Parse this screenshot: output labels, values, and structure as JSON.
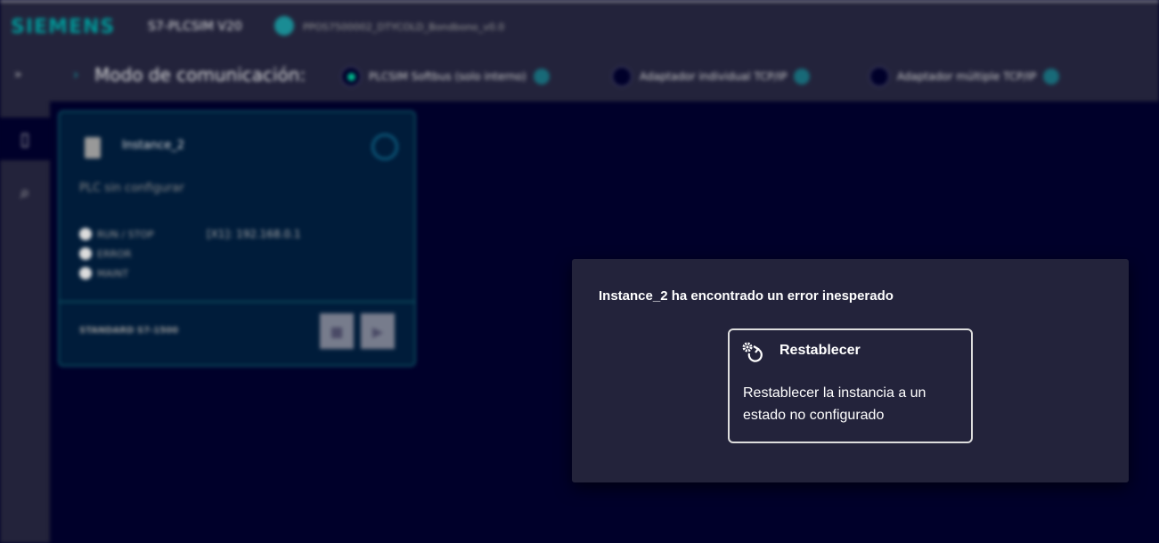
{
  "header": {
    "logo": "SIEMENS",
    "app_title": "S7-PLCSIM V20",
    "project": "PPOS7500002_DTYCOLD_Bondbono_v0.0"
  },
  "mode_bar": {
    "label": "Modo de comunicación:",
    "options": [
      {
        "label": "PLCSIM Softbus (solo interno)",
        "selected": true
      },
      {
        "label": "Adaptador individual TCP/IP",
        "selected": false
      },
      {
        "label": "Adaptador múltiple TCP/IP",
        "selected": false
      }
    ]
  },
  "instance": {
    "name": "Instance_2",
    "status": "PLC sin configurar",
    "leds": [
      "RUN / STOP",
      "ERROR",
      "MAINT"
    ],
    "ip": "[X1]: 192.168.0.1",
    "cpu": "STANDARD S7-1500"
  },
  "dialog": {
    "title": "Instance_2 ha encontrado un error inesperado",
    "action": {
      "label": "Restablecer",
      "description": "Restablecer la instancia a un estado no configurado"
    }
  },
  "colors": {
    "accent": "#009999",
    "selected_radio": "#00b88c",
    "background": "#00002a",
    "panel": "#23233b"
  }
}
